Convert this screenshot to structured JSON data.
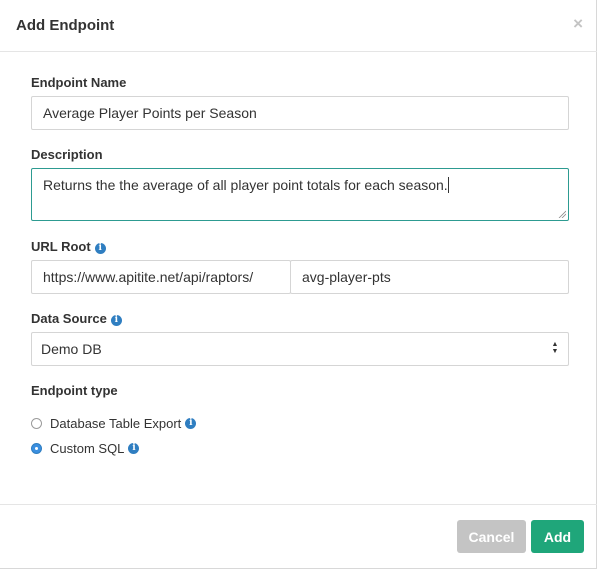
{
  "modal": {
    "title": "Add Endpoint",
    "close_symbol": "×"
  },
  "form": {
    "endpoint_name": {
      "label": "Endpoint Name",
      "value": "Average Player Points per Season"
    },
    "description": {
      "label": "Description",
      "value": "Returns the the average of all player point totals for each season."
    },
    "url_root": {
      "label": "URL Root",
      "info_icon": "info-icon",
      "prefix": "https://www.apitite.net/api/raptors/",
      "slug": "avg-player-pts"
    },
    "data_source": {
      "label": "Data Source",
      "info_icon": "info-icon",
      "selected": "Demo DB"
    },
    "endpoint_type": {
      "label": "Endpoint type",
      "options": [
        {
          "label": "Database Table Export",
          "checked": false,
          "info_icon": "info-icon"
        },
        {
          "label": "Custom SQL",
          "checked": true,
          "info_icon": "info-icon"
        }
      ]
    }
  },
  "footer": {
    "cancel_label": "Cancel",
    "add_label": "Add"
  },
  "colors": {
    "info": "#2f7ec1",
    "add_button": "#1fa67a",
    "cancel_button": "#c4c4c4",
    "focus_border": "#2d9b91"
  }
}
